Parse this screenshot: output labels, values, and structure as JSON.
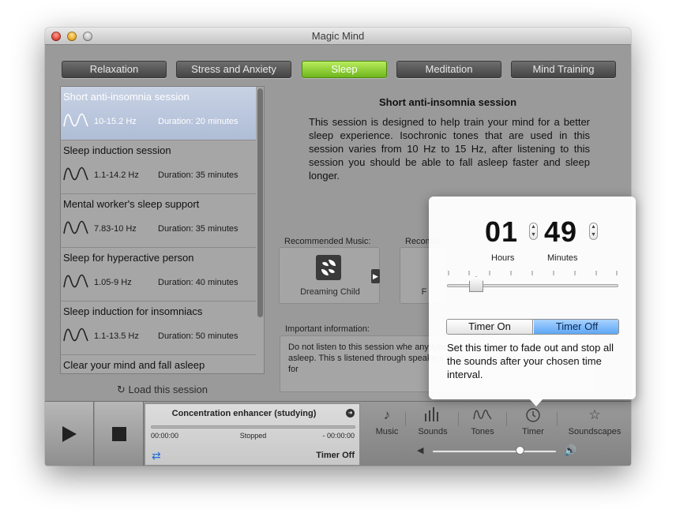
{
  "window": {
    "title": "Magic Mind"
  },
  "categories": [
    "Relaxation",
    "Stress and Anxiety",
    "Sleep",
    "Meditation",
    "Mind Training"
  ],
  "active_category": "Sleep",
  "sessions": [
    {
      "title": "Short anti-insomnia session",
      "hz": "10-15.2 Hz",
      "duration": "Duration: 20 minutes"
    },
    {
      "title": "Sleep induction session",
      "hz": "1.1-14.2 Hz",
      "duration": "Duration: 35 minutes"
    },
    {
      "title": "Mental worker's sleep support",
      "hz": "7.83-10 Hz",
      "duration": "Duration: 35 minutes"
    },
    {
      "title": "Sleep for hyperactive person",
      "hz": "1.05-9 Hz",
      "duration": "Duration: 40 minutes"
    },
    {
      "title": "Sleep induction for insomniacs",
      "hz": "1.1-13.5 Hz",
      "duration": "Duration: 50 minutes"
    },
    {
      "title": "Clear your mind and fall asleep",
      "hz": "",
      "duration": ""
    }
  ],
  "load_label": "Load this session",
  "description": {
    "title": "Short anti-insomnia session",
    "body": "This session is designed to help train your mind for a better sleep experience. Isochronic tones that are used in this session varies from 10 Hz to 15 Hz, after listening to this session you should be able to fall asleep faster and sleep longer."
  },
  "recommended": {
    "music_label": "Recommended Music:",
    "music_name": "Dreaming Child",
    "other_label": "Recomm",
    "other_name": "F"
  },
  "important": {
    "label": "Important information:",
    "text": "Do not listen to this session whe any type of activity where dangerous to fall asleep. This s listened through speakers howe headphones is recommended for"
  },
  "player": {
    "track": "Concentration enhancer (studying)",
    "elapsed": "00:00:00",
    "status": "Stopped",
    "remaining": "- 00:00:00",
    "timer_status": "Timer Off",
    "progress": 0
  },
  "nav": {
    "music": "Music",
    "sounds": "Sounds",
    "tones": "Tones",
    "timer": "Timer",
    "soundscapes": "Soundscapes"
  },
  "volume": 0.7,
  "timer_popover": {
    "hours": "01",
    "minutes": "49",
    "hours_label": "Hours",
    "minutes_label": "Minutes",
    "on_label": "Timer On",
    "off_label": "Timer Off",
    "selected": "off",
    "description": "Set this timer to fade out and stop all the sounds after your chosen time interval."
  },
  "colors": {
    "accent_green": "#7cc224",
    "selection_blue": "#b4c2da",
    "segment_blue": "#6aaff7"
  }
}
